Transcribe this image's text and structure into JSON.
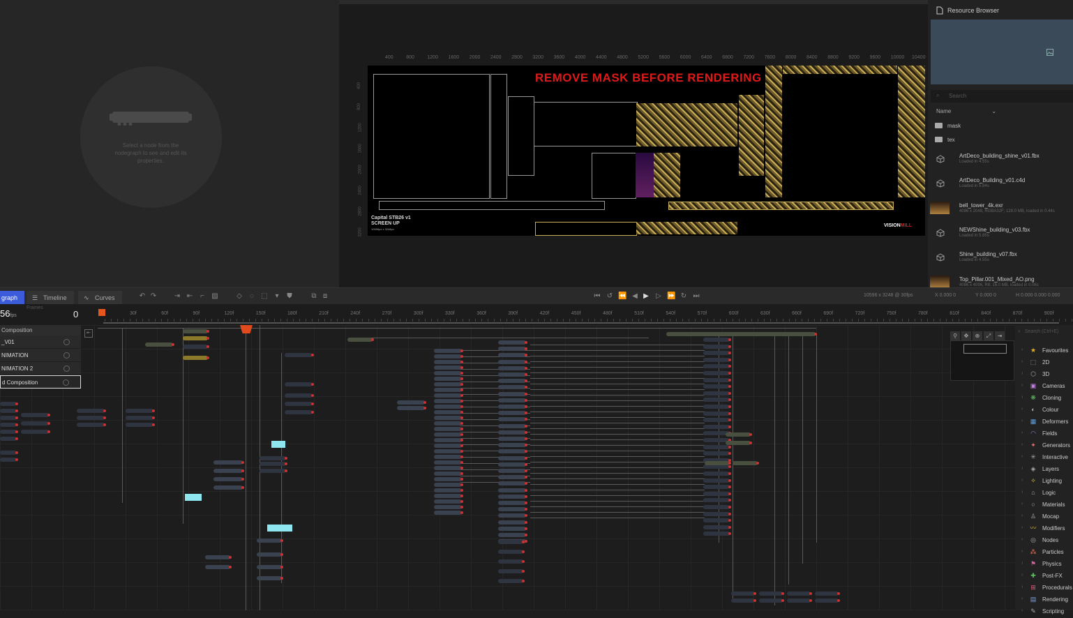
{
  "properties": {
    "hint": "Select a node from the nodegraph to see and edit its properties."
  },
  "viewport": {
    "ruler_ticks": [
      "400",
      "800",
      "1200",
      "1600",
      "2000",
      "2400",
      "2800",
      "3200",
      "3600",
      "4000",
      "4400",
      "4800",
      "5200",
      "5600",
      "6000",
      "6400",
      "6800",
      "7200",
      "7600",
      "8000",
      "8400",
      "8800",
      "9200",
      "9600",
      "10000",
      "10400"
    ],
    "vruler_ticks": [
      "400",
      "800",
      "1200",
      "1600",
      "2000",
      "2400",
      "2800",
      "3200"
    ],
    "warning": "REMOVE MASK BEFORE RENDERING",
    "caption_line1": "Capital STB26 v1",
    "caption_line2": "SCREEN UP",
    "caption_line3": "10596px x 3248px",
    "brand_main": "VISION",
    "brand_accent": "MILL"
  },
  "resources": {
    "title": "Resource Browser",
    "search_placeholder": "Search",
    "sort_label": "Name",
    "folders": [
      "mask",
      "tex"
    ],
    "files": [
      {
        "name": "ArtDeco_building_shine_v01.fbx",
        "sub": "Loaded in 4.55s",
        "kind": "mesh"
      },
      {
        "name": "ArtDeco_Building_v01.c4d",
        "sub": "Loaded in 5.84s",
        "kind": "mesh"
      },
      {
        "name": "bell_tower_4k.exr",
        "sub": "4096 x 2048, RGBA32F; 128.0 MB, loaded in 0.44s",
        "kind": "image"
      },
      {
        "name": "NEWShine_building_v03.fbx",
        "sub": "Loaded in 5.85s",
        "kind": "mesh"
      },
      {
        "name": "Shine_building_v07.fbx",
        "sub": "Loaded in 4.55s",
        "kind": "mesh"
      },
      {
        "name": "Top_Pillar.001_Mixed_AO.png",
        "sub": "4096 x 4096, R8; 16.0 MB, loaded in 0.06s",
        "kind": "image"
      }
    ]
  },
  "toolbar": {
    "tab_nodegraph": "graph",
    "tab_timeline": "Timeline",
    "tab_curves": "Curves",
    "resolution": "10596 x 3248 @ 30fps",
    "x_readout": "X 0.000  0",
    "y_readout": "Y 0.000  0",
    "h_readout": "H 0.000  0.000  0.000"
  },
  "timeline": {
    "fps_value": "56",
    "fps_unit": "fps",
    "frames_label": "Frames",
    "current_frame": "0",
    "frame_ticks": [
      "30f",
      "60f",
      "90f",
      "120f",
      "150f",
      "180f",
      "210f",
      "240f",
      "270f",
      "300f",
      "330f",
      "360f",
      "390f",
      "420f",
      "450f",
      "480f",
      "510f",
      "540f",
      "570f",
      "600f",
      "630f",
      "660f",
      "690f",
      "720f",
      "750f",
      "780f",
      "810f",
      "840f",
      "870f",
      "900f"
    ]
  },
  "layers": {
    "header": "Composition",
    "rows": [
      "_V01",
      "NIMATION",
      "NIMATION 2",
      "d Composition"
    ]
  },
  "library": {
    "search_placeholder": "Search (Ctrl+E)",
    "categories": [
      {
        "label": "Favourites",
        "icon": "★",
        "color": "#e8b020"
      },
      {
        "label": "2D",
        "icon": "⬚",
        "color": "#aaaaaa"
      },
      {
        "label": "3D",
        "icon": "⬡",
        "color": "#aaaaaa"
      },
      {
        "label": "Cameras",
        "icon": "▣",
        "color": "#c080e0"
      },
      {
        "label": "Cloning",
        "icon": "❋",
        "color": "#60c060"
      },
      {
        "label": "Colour",
        "icon": "◐",
        "color": "#aaaaaa"
      },
      {
        "label": "Deformers",
        "icon": "▦",
        "color": "#60a0e0"
      },
      {
        "label": "Fields",
        "icon": "◠",
        "color": "#a080e0"
      },
      {
        "label": "Generators",
        "icon": "✦",
        "color": "#e07070"
      },
      {
        "label": "Interactive",
        "icon": "✳",
        "color": "#aaaaaa"
      },
      {
        "label": "Layers",
        "icon": "◈",
        "color": "#aaaaaa"
      },
      {
        "label": "Lighting",
        "icon": "✧",
        "color": "#e8d040"
      },
      {
        "label": "Logic",
        "icon": "⌂",
        "color": "#aaaaaa"
      },
      {
        "label": "Materials",
        "icon": "○",
        "color": "#aaaaaa"
      },
      {
        "label": "Mocap",
        "icon": "♙",
        "color": "#aaaaaa"
      },
      {
        "label": "Modifiers",
        "icon": "〰",
        "color": "#e0c040"
      },
      {
        "label": "Nodes",
        "icon": "◎",
        "color": "#aaaaaa"
      },
      {
        "label": "Particles",
        "icon": "⁂",
        "color": "#e07050"
      },
      {
        "label": "Physics",
        "icon": "⚑",
        "color": "#d060a0"
      },
      {
        "label": "Post-FX",
        "icon": "✚",
        "color": "#60c060"
      },
      {
        "label": "Procedurals",
        "icon": "⊞",
        "color": "#e06080"
      },
      {
        "label": "Rendering",
        "icon": "▤",
        "color": "#80a0e0"
      },
      {
        "label": "Scripting",
        "icon": "✎",
        "color": "#aaaaaa"
      }
    ]
  },
  "nodegraph": {
    "notes": [
      "",
      "",
      ""
    ]
  },
  "colors": {
    "accent": "#3b5bdb",
    "playhead": "#e8561c",
    "warning": "#e01818",
    "note": "#8ee6f0"
  }
}
